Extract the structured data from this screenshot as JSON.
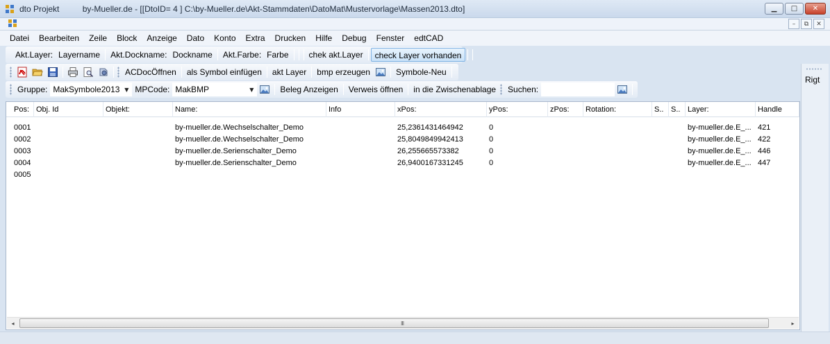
{
  "window": {
    "app_name": "dto Projekt",
    "title": "by-Mueller.de - [[DtoID= 4 ] C:\\by-Mueller.de\\Akt-Stammdaten\\DatoMat\\Mustervorlage\\Massen2013.dto]",
    "minimize_glyph": "▁",
    "maximize_glyph": "□",
    "close_glyph": "✕",
    "mdi_minimize_glyph": "–",
    "mdi_restore_glyph": "⧉",
    "mdi_close_glyph": "✕"
  },
  "menu": [
    "Datei",
    "Bearbeiten",
    "Zeile",
    "Block",
    "Anzeige",
    "Dato",
    "Konto",
    "Extra",
    "Drucken",
    "Hilfe",
    "Debug",
    "Fenster",
    "edtCAD"
  ],
  "toolbar1": {
    "akt_layer_label": "Akt.Layer:",
    "akt_layer_value": "Layername",
    "akt_dockname_label": "Akt.Dockname:",
    "akt_dockname_value": "Dockname",
    "akt_farbe_label": "Akt.Farbe:",
    "akt_farbe_value": "Farbe",
    "chek_akt_layer": "chek akt.Layer",
    "check_layer_vorhanden": "check Layer vorhanden"
  },
  "toolbar2": {
    "icons": [
      "pdf-icon",
      "open-folder-icon",
      "save-icon",
      "print-icon",
      "print-preview-icon",
      "settings-icon"
    ],
    "acdoc_oeffnen": "ACDocÖffnen",
    "als_symbol_einfuegen": "als Symbol einfügen",
    "akt_layer": "akt Layer",
    "bmp_erzeugen": "bmp erzeugen",
    "symbole_neu": "Symbole-Neu"
  },
  "toolbar3": {
    "gruppe_label": "Gruppe:",
    "gruppe_value": "MakSymbole2013",
    "mpcode_label": "MPCode:",
    "mpcode_value": "MakBMP",
    "beleg_anzeigen": "Beleg Anzeigen",
    "verweis_oeffnen": "Verweis öffnen",
    "zwischenablage": "in die Zwischenablage",
    "suchen_label": "Suchen:",
    "suchen_value": ""
  },
  "right_panel": {
    "label": "Rigt"
  },
  "grid": {
    "columns": [
      "Pos:",
      "Obj. Id",
      "Objekt:",
      "Name:",
      "Info",
      "xPos:",
      "yPos:",
      "zPos:",
      "Rotation:",
      "S..",
      "S..",
      "Layer:",
      "Handle"
    ],
    "rows": [
      [
        "0001",
        "",
        "",
        "by-mueller.de.Wechselschalter_Demo",
        "",
        "25,2361431464942",
        "0",
        "",
        "",
        "",
        "",
        "by-mueller.de.E_...",
        "421"
      ],
      [
        "0002",
        "",
        "",
        "by-mueller.de.Wechselschalter_Demo",
        "",
        "25,8049849942413",
        "0",
        "",
        "",
        "",
        "",
        "by-mueller.de.E_...",
        "422"
      ],
      [
        "0003",
        "",
        "",
        "by-mueller.de.Serienschalter_Demo",
        "",
        "26,255665573382",
        "0",
        "",
        "",
        "",
        "",
        "by-mueller.de.E_...",
        "446"
      ],
      [
        "0004",
        "",
        "",
        "by-mueller.de.Serienschalter_Demo",
        "",
        "26,9400167331245",
        "0",
        "",
        "",
        "",
        "",
        "by-mueller.de.E_...",
        "447"
      ],
      [
        "0005",
        "",
        "",
        "",
        "",
        "",
        "",
        "",
        "",
        "",
        "",
        "",
        ""
      ]
    ],
    "scroll_left_glyph": "◂",
    "scroll_right_glyph": "▸",
    "scroll_grip": "III"
  }
}
